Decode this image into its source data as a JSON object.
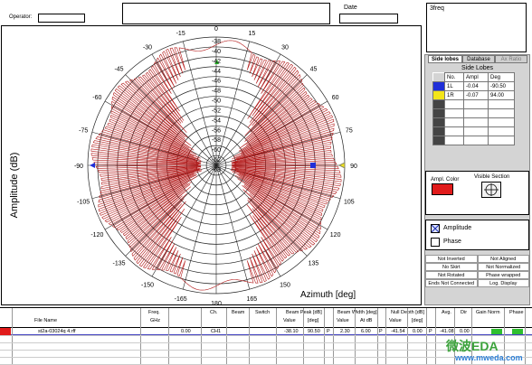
{
  "header": {
    "operator_label": "Operator:",
    "operator_value": "",
    "notes_value": "",
    "date_label": "Date",
    "date_value": "",
    "comment_value": "3freq"
  },
  "plot": {
    "ylabel": "Amplitude (dB)",
    "xlabel": "Azimuth  [deg]",
    "radial_labels": [
      "-38",
      "-40",
      "-42",
      "-44",
      "-46",
      "-48",
      "-50",
      "-52",
      "-54",
      "-56",
      "-58",
      "-60",
      "-62",
      "-63"
    ],
    "angle_labels": [
      "0",
      "-15",
      "15",
      "30",
      "-30",
      "-45",
      "45",
      "-60",
      "60",
      "-75",
      "75",
      "-90",
      "90",
      "-105",
      "105",
      "-120",
      "120",
      "-135",
      "135",
      "-150",
      "150",
      "-165",
      "165",
      "180"
    ]
  },
  "tabs": [
    "Side lobes",
    "Database",
    "Ax Ratio"
  ],
  "side_lobes": {
    "title": "Side Lobes",
    "headers": [
      "No.",
      "Ampl",
      "Deg"
    ],
    "rows": [
      {
        "no": "1L",
        "ampl": "-0.04",
        "deg": "-90.50",
        "color": "#1f2fd8"
      },
      {
        "no": "1R",
        "ampl": "-0.07",
        "deg": "94.00",
        "color": "#f3e51a"
      },
      {
        "no": "",
        "ampl": "",
        "deg": "",
        "color": "#444444"
      },
      {
        "no": "",
        "ampl": "",
        "deg": "",
        "color": "#444444"
      },
      {
        "no": "",
        "ampl": "",
        "deg": "",
        "color": "#444444"
      },
      {
        "no": "",
        "ampl": "",
        "deg": "",
        "color": "#444444"
      },
      {
        "no": "",
        "ampl": "",
        "deg": "",
        "color": "#444444"
      }
    ]
  },
  "ampl_color": {
    "label": "Ampl. Color",
    "color": "#e11b1b"
  },
  "visible_section": {
    "label": "Visible Section"
  },
  "options": {
    "amplitude": "Amplitude",
    "phase": "Phase"
  },
  "flags": [
    [
      "Not Inverted",
      "Not Aligned"
    ],
    [
      "No Skirt",
      "Not Normalized"
    ],
    [
      "Not Rotated",
      "Phase wrapped"
    ],
    [
      "Ends Not Connected",
      "Log. Display"
    ]
  ],
  "table": {
    "headers": {
      "file_name": "File Name",
      "freq": "Freq.",
      "ghz": "GHz",
      "ch": "Ch.",
      "beam": "Beam",
      "switch": "Switch",
      "beam_peak": "Beam Peak [dB]",
      "value": "Value",
      "deg": "[deg]",
      "beam_width": "Beam Width [deg]",
      "at_db": "At dB",
      "null_depth": "Null Depth [dB]",
      "avg": "Avg.",
      "dir": "Dir",
      "gain_norm": "Gain Norm",
      "phase": "Phase"
    },
    "row": {
      "file_name": "st2a-03024q 4.rff",
      "freq": "0.00",
      "ch": "CH1",
      "peak_value": "-38.10",
      "peak_deg": "90.50",
      "p1": "P",
      "bw_value": "2.30",
      "bw_at": "6.00",
      "p2": "P",
      "null_value": "-41.54",
      "null_deg": "0.00",
      "p3": "P",
      "avg": "-41.08",
      "dir": "0.00"
    }
  },
  "watermark": {
    "cn": "微波EDA",
    "url": "www.mweda.com"
  },
  "colors": {
    "trace": "#b31818",
    "grid": "#222222",
    "accent": "#e11b1b"
  }
}
